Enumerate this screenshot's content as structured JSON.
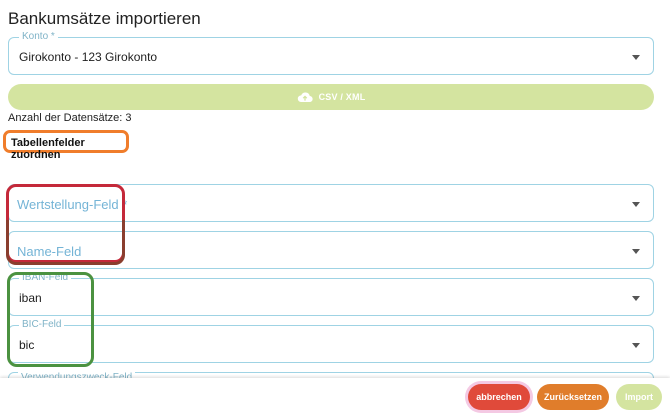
{
  "page": {
    "title": "Bankumsätze importieren"
  },
  "account": {
    "label": "Konto *",
    "value": "Girokonto - 123 Girokonto"
  },
  "upload": {
    "label": "CSV / XML",
    "icon": "cloud-upload-icon"
  },
  "records": {
    "text": "Anzahl der Datensätze: 3"
  },
  "mapping": {
    "heading": "Tabellenfelder zuordnen",
    "fields": [
      {
        "placeholder": "Wertstellung-Feld *"
      },
      {
        "placeholder": "Name-Feld"
      },
      {
        "label": "IBAN-Feld",
        "value": "iban"
      },
      {
        "label": "BIC-Feld",
        "value": "bic"
      },
      {
        "label": "Verwendungszweck-Feld"
      }
    ]
  },
  "actions": {
    "cancel": "abbrechen",
    "reset": "Zurücksetzen",
    "import": "Import"
  },
  "colors": {
    "field_border": "#9fd3e4",
    "upload_bg": "#d4e4a0",
    "cancel_bg": "#e04a3a",
    "reset_bg": "#e07d2b",
    "highlight_orange": "#f07d2b",
    "highlight_red": "#c4293a",
    "highlight_green": "#4b9240"
  }
}
